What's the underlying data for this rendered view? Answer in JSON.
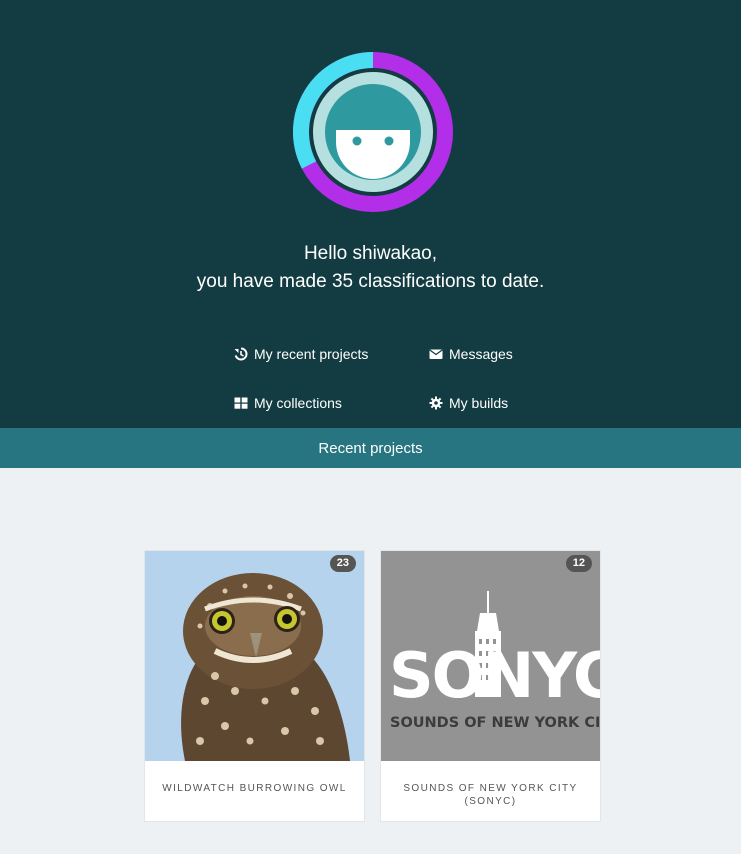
{
  "header": {
    "greeting_line1": "Hello shiwakao,",
    "greeting_line2": "you have made 35 classifications to date.",
    "avatar_ring_colors": {
      "left": "#49def2",
      "right": "#b32ee8"
    },
    "links": {
      "recent_projects": {
        "label": "My recent projects",
        "icon": "history-icon"
      },
      "messages": {
        "label": "Messages",
        "icon": "envelope-icon"
      },
      "collections": {
        "label": "My collections",
        "icon": "grid-icon"
      },
      "builds": {
        "label": "My builds",
        "icon": "gear-icon"
      }
    }
  },
  "tabs": {
    "active": "Recent projects"
  },
  "projects": [
    {
      "title": "Wildwatch Burrowing Owl",
      "count": "23",
      "thumb": "owl-photo"
    },
    {
      "title": "Sounds of New York City (SONYC)",
      "count": "12",
      "thumb": "sonyc-logo",
      "logo_text": "SONYC",
      "logo_subtitle": "SOUNDS OF NEW YORK CITY"
    }
  ],
  "colors": {
    "hero_bg": "#133c42",
    "tab_bg": "#267580",
    "page_bg": "#eef1f4"
  }
}
